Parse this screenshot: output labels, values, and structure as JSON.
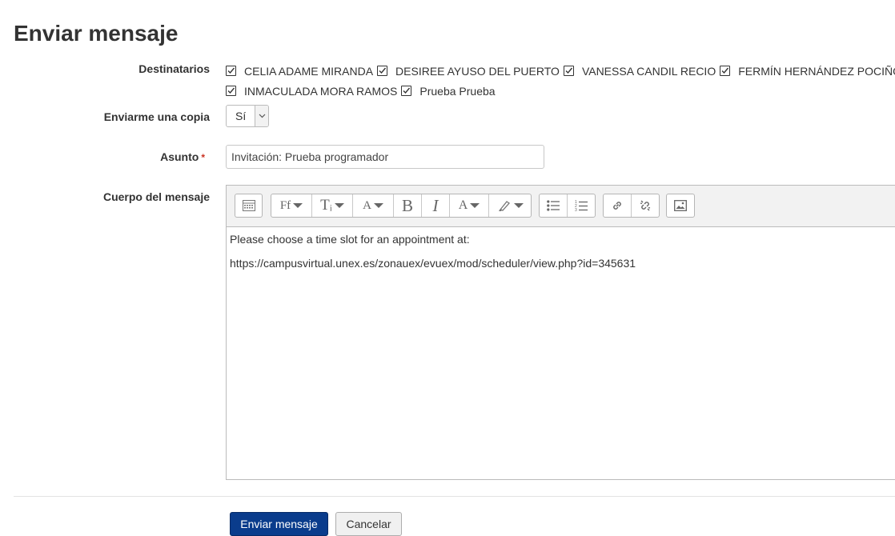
{
  "page": {
    "title": "Enviar mensaje"
  },
  "form": {
    "recipients": {
      "label": "Destinatarios",
      "items": [
        {
          "name": "CELIA ADAME MIRANDA",
          "checked": true
        },
        {
          "name": "DESIREE AYUSO DEL PUERTO",
          "checked": true
        },
        {
          "name": "VANESSA CANDIL RECIO",
          "checked": true
        },
        {
          "name": "FERMÍN HERNÁNDEZ POCIÑO",
          "checked": true
        },
        {
          "name": "INMACULADA MORA RAMOS",
          "checked": true
        },
        {
          "name": "Prueba Prueba",
          "checked": true
        }
      ]
    },
    "copy": {
      "label": "Enviarme una copia",
      "value": "Sí"
    },
    "subject": {
      "label": "Asunto",
      "required_mark": "*",
      "value": "Invitación: Prueba programador"
    },
    "body": {
      "label": "Cuerpo del mensaje",
      "toolbar_icons": [
        "toolbar-toggle-icon",
        "font-family-icon",
        "font-size-icon",
        "style-icon",
        "bold-icon",
        "italic-icon",
        "font-color-icon",
        "highlight-color-icon",
        "unordered-list-icon",
        "ordered-list-icon",
        "link-icon",
        "unlink-icon",
        "image-icon"
      ],
      "toolbar_glyphs": {
        "font_family": "Ff",
        "font_size": "Tᵢ",
        "style": "A",
        "bold": "B",
        "italic": "I",
        "font_color": "A"
      },
      "paragraphs": [
        "Please choose a time slot for an appointment at:",
        "https://campusvirtual.unex.es/zonauex/evuex/mod/scheduler/view.php?id=345631"
      ]
    }
  },
  "actions": {
    "submit_label": "Enviar mensaje",
    "cancel_label": "Cancelar"
  },
  "colors": {
    "primary_button": "#0a3c8c",
    "required": "#ca3120"
  }
}
